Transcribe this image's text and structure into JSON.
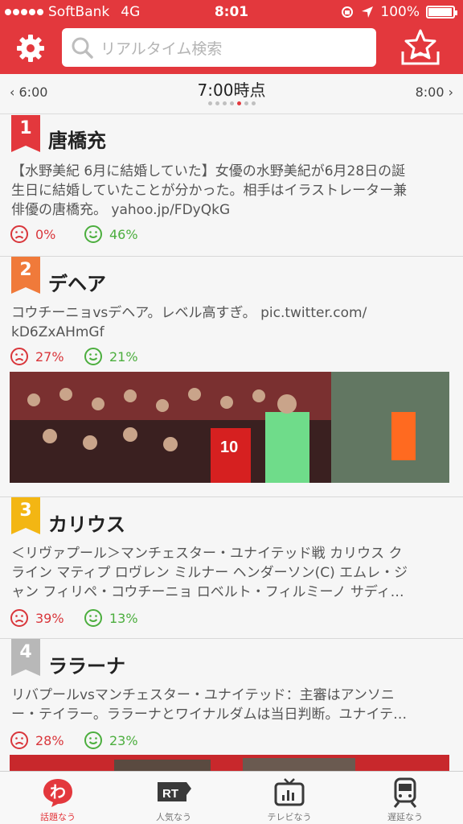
{
  "status_bar": {
    "carrier": "SoftBank",
    "network": "4G",
    "time": "8:01",
    "battery": "100%"
  },
  "header": {
    "search_placeholder": "リアルタイム検索"
  },
  "time_nav": {
    "prev": "6:00",
    "current": "7:00時点",
    "next": "8:00",
    "page_count": 7,
    "active_page": 5
  },
  "colors": {
    "brand": "#e3383d",
    "negative": "#d9363b",
    "positive": "#4cae3e",
    "rank1": "#e3383d",
    "rank2": "#f07a3a",
    "rank3": "#f3b613",
    "rank4": "#b8b8b8"
  },
  "topics": [
    {
      "rank": "1",
      "title": "唐橋充",
      "lines": [
        "【水野美紀 6月に結婚していた】女優の水野美紀が6月28日の誕",
        "生日に結婚していたことが分かった。相手はイラストレーター兼",
        "俳優の唐橋充。 yahoo.jp/FDyQkG"
      ],
      "negative": "0%",
      "positive": "46%",
      "has_image": false
    },
    {
      "rank": "2",
      "title": "デヘア",
      "lines": [
        "コウチーニョvsデヘア。レベル高すぎ。 pic.twitter.com/",
        "kD6ZxAHmGf"
      ],
      "negative": "27%",
      "positive": "21%",
      "has_image": true,
      "image_desc": "soccer-photo",
      "jersey": "10"
    },
    {
      "rank": "3",
      "title": "カリウス",
      "lines": [
        "＜リヴァプール＞マンチェスター・ユナイテッド戦 カリウス ク",
        "ライン マティプ ロヴレン ミルナー ヘンダーソン(C) エムレ・ジ",
        "ャン フィリペ・コウチーニョ ロベルト・フィルミーノ サディ…"
      ],
      "negative": "39%",
      "positive": "13%",
      "has_image": false
    },
    {
      "rank": "4",
      "title": "ララーナ",
      "lines": [
        "リバプールvsマンチェスター・ユナイテッド：主審はアンソニ",
        "ー・テイラー。ララーナとワイナルダムは当日判断。ユナイテ…"
      ],
      "negative": "28%",
      "positive": "23%",
      "has_image": true,
      "image_desc": "photo-partial"
    }
  ],
  "tabs": [
    {
      "label": "話題なう",
      "icon": "wa-icon",
      "active": true
    },
    {
      "label": "人気なう",
      "icon": "rt-icon",
      "active": false
    },
    {
      "label": "テレビなう",
      "icon": "tv-icon",
      "active": false
    },
    {
      "label": "遅延なう",
      "icon": "train-icon",
      "active": false
    }
  ]
}
